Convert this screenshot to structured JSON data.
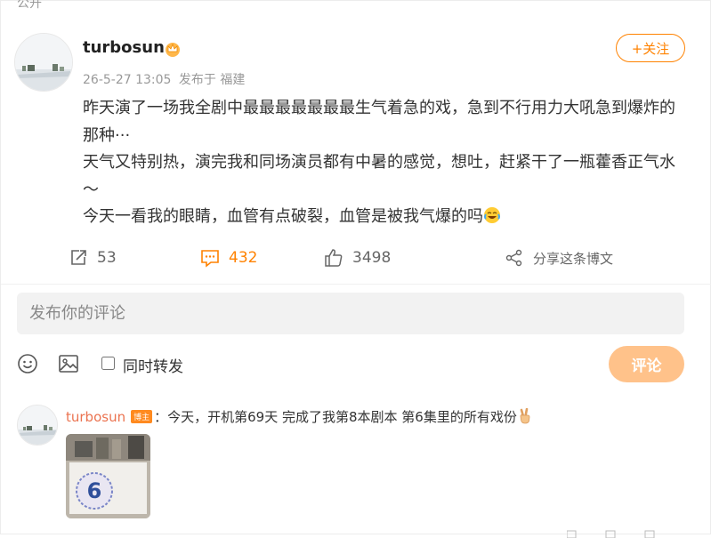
{
  "header": {
    "cut_text": "公开"
  },
  "post": {
    "username": "turbosun",
    "timestamp": "26-5-27 13:05",
    "source": "发布于 福建",
    "follow_label": "+关注",
    "lines": [
      "昨天演了一场我全剧中最最最最最最最生气着急的戏，急到不行用力大吼急到爆炸的那种···",
      "天气又特别热，演完我和同场演员都有中暑的感觉，想吐，赶紧干了一瓶藿香正气水～",
      "今天一看我的眼睛，血管有点破裂，血管是被我气爆的吗"
    ]
  },
  "actions": {
    "repost_count": "53",
    "comment_count": "432",
    "like_count": "3498",
    "share_label": "分享这条博文"
  },
  "compose": {
    "placeholder": "发布你的评论",
    "repost_label": "同时转发",
    "submit_label": "评论"
  },
  "comment": {
    "username": "turbosun",
    "badge": "博主",
    "text": "：今天，开机第69天 完成了我第8本剧本 第6集里的所有戏份",
    "image_number": "6"
  },
  "colors": {
    "accent": "#ff8200",
    "comment_user": "#eb7350",
    "submit_disabled": "#ffc28a",
    "input_bg": "#f2f2f2"
  },
  "icons": [
    "crown-icon",
    "repost-icon",
    "comment-icon",
    "like-icon",
    "share-icon",
    "emoji-icon",
    "image-icon",
    "victory-hand-icon",
    "crying-laugh-icon"
  ]
}
